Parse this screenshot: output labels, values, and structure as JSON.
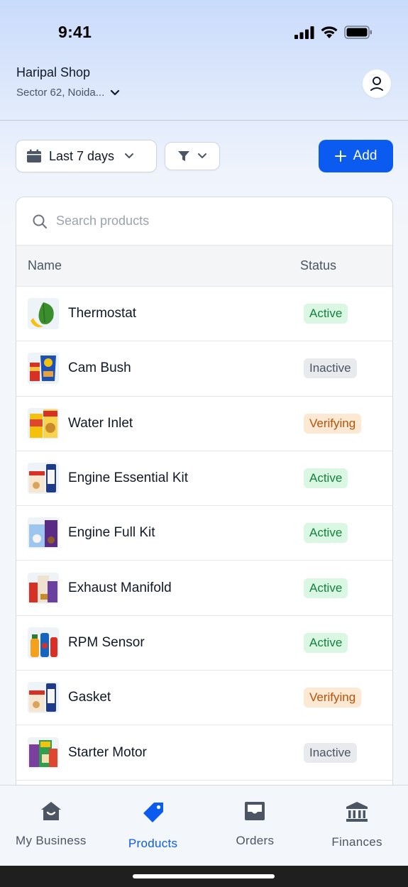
{
  "status_bar": {
    "time": "9:41"
  },
  "shop": {
    "name": "Haripal Shop",
    "location": "Sector 62, Noida..."
  },
  "toolbar": {
    "date_range": "Last 7 days",
    "add_label": "Add"
  },
  "search": {
    "placeholder": "Search products",
    "value": ""
  },
  "table": {
    "headers": {
      "name": "Name",
      "status": "Status"
    },
    "rows": [
      {
        "name": "Thermostat",
        "status": "Active"
      },
      {
        "name": "Cam Bush",
        "status": "Inactive"
      },
      {
        "name": "Water Inlet",
        "status": "Verifying"
      },
      {
        "name": "Engine Essential Kit",
        "status": "Active"
      },
      {
        "name": "Engine Full Kit",
        "status": "Active"
      },
      {
        "name": "Exhaust Manifold",
        "status": "Active"
      },
      {
        "name": "RPM Sensor",
        "status": "Active"
      },
      {
        "name": "Gasket",
        "status": "Verifying"
      },
      {
        "name": "Starter Motor",
        "status": "Inactive"
      }
    ]
  },
  "nav": {
    "items": [
      {
        "label": "My Business",
        "icon": "home-icon",
        "active": false
      },
      {
        "label": "Products",
        "icon": "tag-icon",
        "active": true
      },
      {
        "label": "Orders",
        "icon": "inbox-icon",
        "active": false
      },
      {
        "label": "Finances",
        "icon": "bank-icon",
        "active": false
      }
    ]
  },
  "colors": {
    "accent": "#0b5bf0",
    "active_bg": "#d9f7e3",
    "active_fg": "#15803d",
    "inactive_bg": "#e8eaed",
    "inactive_fg": "#4b5563",
    "verifying_bg": "#fde8d4",
    "verifying_fg": "#b45309"
  }
}
